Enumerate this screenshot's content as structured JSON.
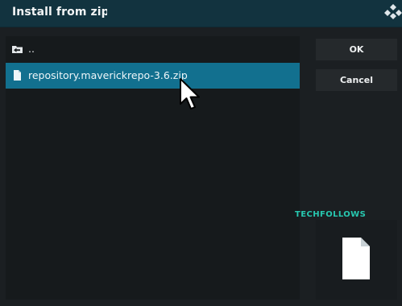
{
  "dialog": {
    "title": "Install from zip file",
    "logo_icon": "kodi-logo-icon"
  },
  "file_list": {
    "items": [
      {
        "label": "..",
        "icon": "folder-up-icon",
        "selected": false
      },
      {
        "label": "repository.maverickrepo-3.6.zip",
        "icon": "file-icon",
        "selected": true
      }
    ]
  },
  "buttons": {
    "ok_label": "OK",
    "cancel_label": "Cancel"
  },
  "watermark": {
    "text": "TECHFOLLOWS"
  },
  "preview": {
    "icon": "file-icon"
  },
  "colors": {
    "titlebar": "#12333f",
    "selection": "#12708f",
    "watermark": "#27c8b0"
  }
}
